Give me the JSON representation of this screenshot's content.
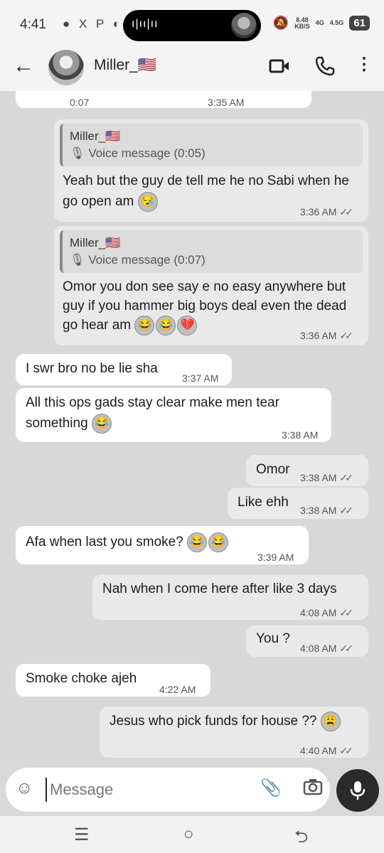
{
  "status": {
    "time": "4:41",
    "left_icons": "● X P ◐",
    "speed": "8.48\nKB/S",
    "net1": "4G",
    "net2": "4.5G",
    "battery": "61"
  },
  "header": {
    "contact_name": "Miller_🇺🇸"
  },
  "messages": {
    "m0": {
      "text": "0:07",
      "time": "3:35 AM"
    },
    "m1": {
      "quote_name": "Miller_🇺🇸",
      "quote_text": "Voice message (0:05)",
      "text": "Yeah  but the guy de tell me he no Sabi when he go open am",
      "emoji": "😴",
      "time": "3:36 AM"
    },
    "m2": {
      "quote_name": "Miller_🇺🇸",
      "quote_text": "Voice message (0:07)",
      "text": "Omor you don see say e no easy anywhere but guy if you hammer big boys deal even the dead go hear am",
      "emoji": "😂😂💔",
      "time": "3:36 AM"
    },
    "m3": {
      "text": "I swr bro no be lie sha",
      "time": "3:37 AM"
    },
    "m4": {
      "text": "All this ops gads stay clear make men tear something",
      "emoji": "😂",
      "time": "3:38 AM"
    },
    "m5": {
      "text": "Omor",
      "time": "3:38 AM"
    },
    "m6": {
      "text": "Like ehh",
      "time": "3:38 AM"
    },
    "m7": {
      "text": "Afa when last you smoke?",
      "emoji": "😂😂",
      "time": "3:39 AM"
    },
    "m8": {
      "text": "Nah when I come here after like 3 days",
      "time": "4:08 AM"
    },
    "m9": {
      "text": "You ?",
      "time": "4:08 AM"
    },
    "m10": {
      "text": "Smoke choke ajeh",
      "time": "4:22 AM"
    },
    "m11": {
      "text": "Jesus who pick funds for house ??",
      "emoji": "😩",
      "time": "4:40 AM"
    }
  },
  "input": {
    "placeholder": "Message"
  },
  "icons": {
    "back": "back-arrow-icon",
    "video": "video-call-icon",
    "phone": "phone-icon",
    "more": "more-vertical-icon",
    "sticker": "sticker-icon",
    "attach": "paperclip-icon",
    "camera": "camera-icon",
    "mic": "microphone-icon"
  },
  "colors": {
    "background": "#d8d8d8",
    "incoming": "#ffffff",
    "outgoing": "#e9e9e9"
  }
}
